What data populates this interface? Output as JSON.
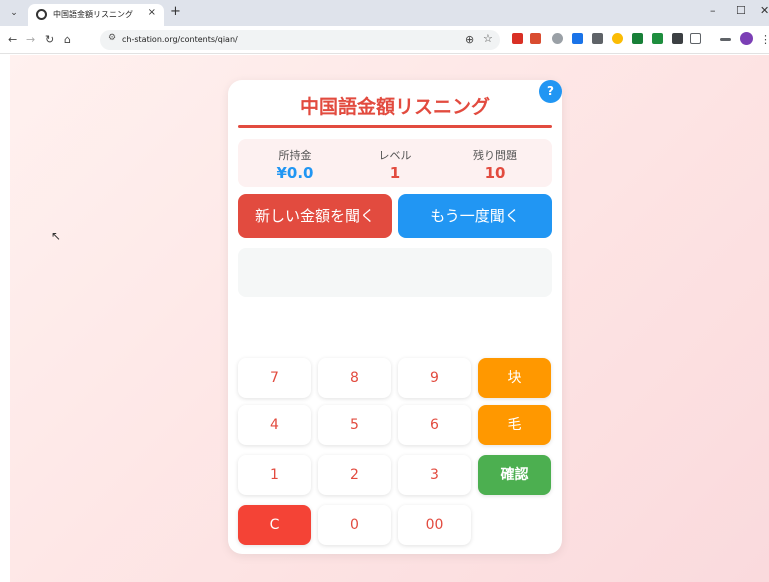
{
  "browser": {
    "tab_title": "中国語金額リスニング",
    "tab_close": "×",
    "new_tab": "+",
    "url": "ch-station.org/contents/qian/",
    "win_min": "–",
    "win_max": "☐",
    "win_close": "✕"
  },
  "app": {
    "title": "中国語金額リスニング",
    "help_label": "?",
    "stats": [
      {
        "label": "所持金",
        "value": "¥0.0",
        "color": "#2196f3"
      },
      {
        "label": "レベル",
        "value": "1",
        "color": "#e24b3f"
      },
      {
        "label": "残り問題",
        "value": "10",
        "color": "#e24b3f"
      }
    ],
    "new_amount_label": "新しい金額を聞く",
    "replay_label": "もう一度聞く",
    "answer_value": "",
    "keypad": {
      "row1": [
        "7",
        "8",
        "9",
        "块"
      ],
      "row2": [
        "4",
        "5",
        "6",
        "毛"
      ],
      "row3": [
        "1",
        "2",
        "3",
        "確認"
      ],
      "row4": [
        "C",
        "0",
        "00"
      ]
    }
  },
  "colors": {
    "accent_red": "#e24b3f",
    "accent_blue": "#2196f3",
    "unit_orange": "#ff9800",
    "confirm_green": "#4caf50",
    "clear_red": "#f44336"
  }
}
